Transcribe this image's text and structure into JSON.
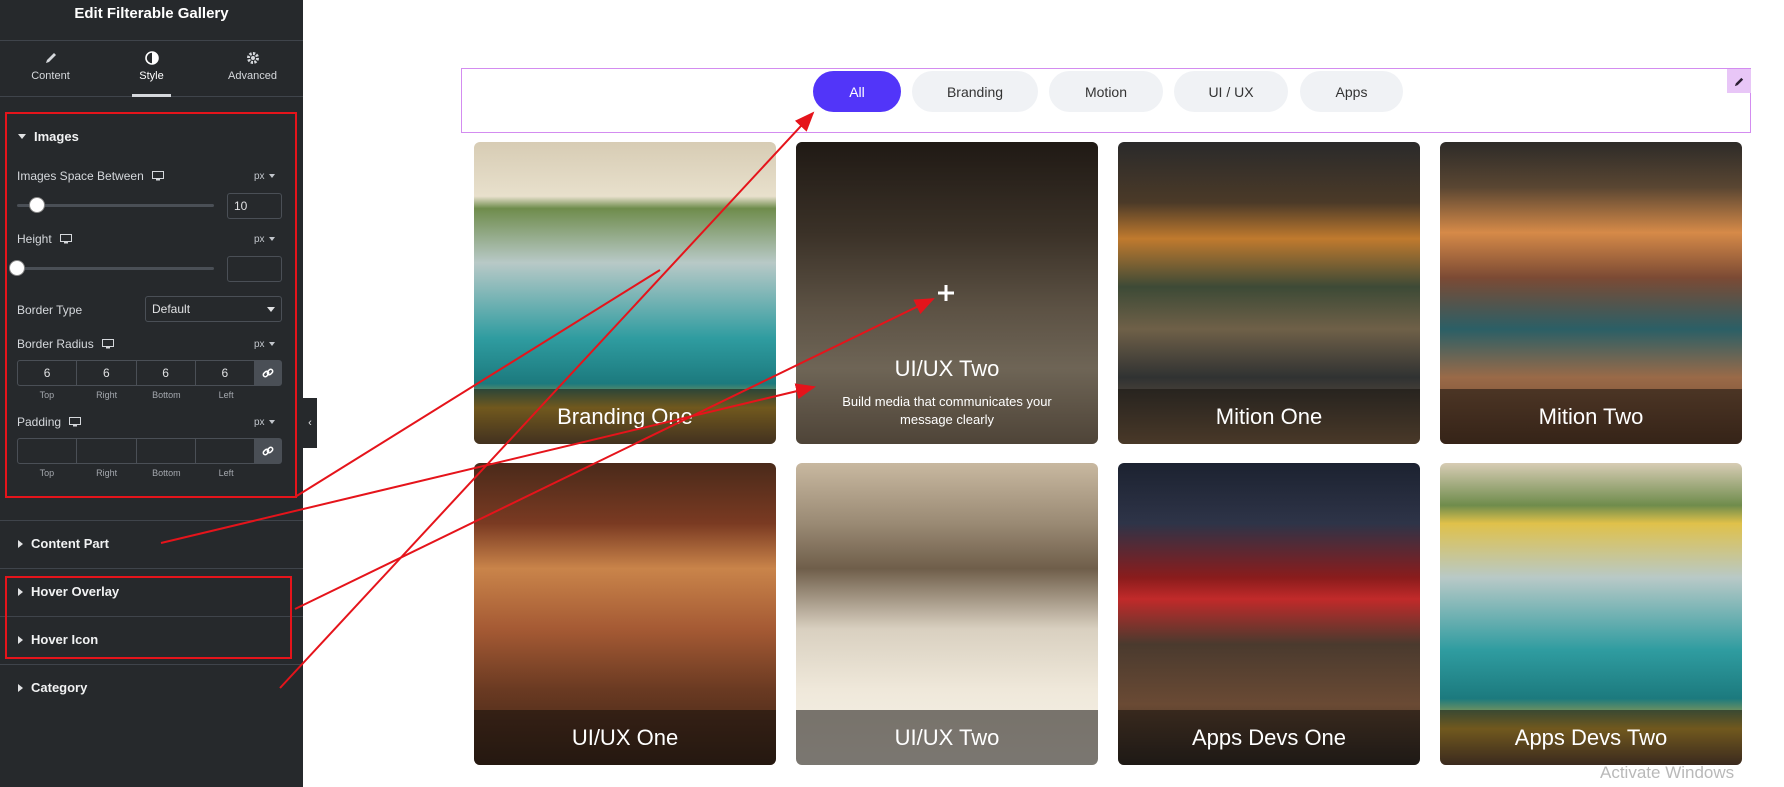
{
  "panel": {
    "title": "Edit Filterable Gallery",
    "tabs": [
      {
        "label": "Content",
        "icon": "pencil-icon"
      },
      {
        "label": "Style",
        "icon": "contrast-icon"
      },
      {
        "label": "Advanced",
        "icon": "gear-icon"
      }
    ],
    "images_section": {
      "title": "Images",
      "space_between": {
        "label": "Images Space Between",
        "unit": "px",
        "value": "10"
      },
      "height": {
        "label": "Height",
        "unit": "px",
        "value": ""
      },
      "border_type": {
        "label": "Border Type",
        "value": "Default"
      },
      "border_radius": {
        "label": "Border Radius",
        "unit": "px",
        "values": [
          "6",
          "6",
          "6",
          "6"
        ],
        "labels": [
          "Top",
          "Right",
          "Bottom",
          "Left"
        ]
      },
      "padding": {
        "label": "Padding",
        "unit": "px",
        "values": [
          "",
          "",
          "",
          ""
        ],
        "labels": [
          "Top",
          "Right",
          "Bottom",
          "Left"
        ]
      }
    },
    "sections": [
      "Content Part",
      "Hover Overlay",
      "Hover Icon",
      "Category"
    ]
  },
  "gallery": {
    "filters": [
      "All",
      "Branding",
      "Motion",
      "UI / UX",
      "Apps"
    ],
    "active_filter": "All",
    "accent_color": "#5235f9",
    "cards": [
      {
        "title": "Branding One"
      },
      {
        "title": "UI/UX Two",
        "description": "Build media that communicates your message clearly",
        "state": "hover"
      },
      {
        "title": "Mition One"
      },
      {
        "title": "Mition Two"
      },
      {
        "title": "UI/UX One"
      },
      {
        "title": "UI/UX Two"
      },
      {
        "title": "Apps Devs One"
      },
      {
        "title": "Apps Devs Two"
      }
    ]
  },
  "watermark": "Activate Windows"
}
